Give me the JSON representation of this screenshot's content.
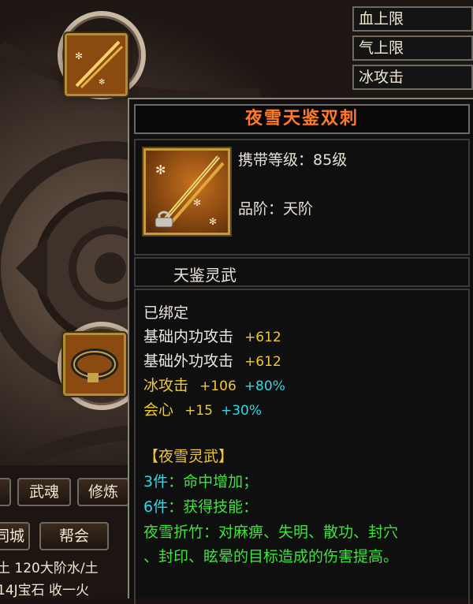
{
  "side_menu": [
    "血上限",
    "气上限",
    "冰攻击"
  ],
  "bottom_bar": {
    "row1": [
      "武魂",
      "修炼"
    ],
    "row2": [
      "同城",
      "帮会"
    ],
    "text_line1": "土  120大阶水/土",
    "text_line2": "14J宝石  收一火"
  },
  "item": {
    "name": "夜雪天鉴双刺",
    "carry_level_label": "携带等级：",
    "carry_level_value": "85级",
    "grade_label": "品阶：",
    "grade_value": "天阶",
    "category": "天鉴灵武",
    "bound": "已绑定",
    "stats": [
      {
        "name": "基础内功攻击",
        "value": "+612",
        "bonus": ""
      },
      {
        "name": "基础外功攻击",
        "value": "+612",
        "bonus": ""
      },
      {
        "name": "冰攻击",
        "value": "+106",
        "bonus": "+80%"
      },
      {
        "name": "会心",
        "value": "+15",
        "bonus": "+30%"
      }
    ],
    "set": {
      "title": "【夜雪灵武】",
      "bonus3_count": "3件",
      "bonus3_text": "：命中增加；",
      "bonus6_count": "6件",
      "bonus6_text": "：获得技能：",
      "skill_line1": "夜雪折竹：对麻痹、失明、散功、封穴",
      "skill_line2": "、封印、眩晕的目标造成的伤害提高。"
    }
  },
  "colors": {
    "title": "#ff7a2a",
    "stat_value": "#f0c830",
    "stat_bonus": "#2fd8e6",
    "set_green": "#3ee33c",
    "cyan_count": "#2fd8e6"
  }
}
